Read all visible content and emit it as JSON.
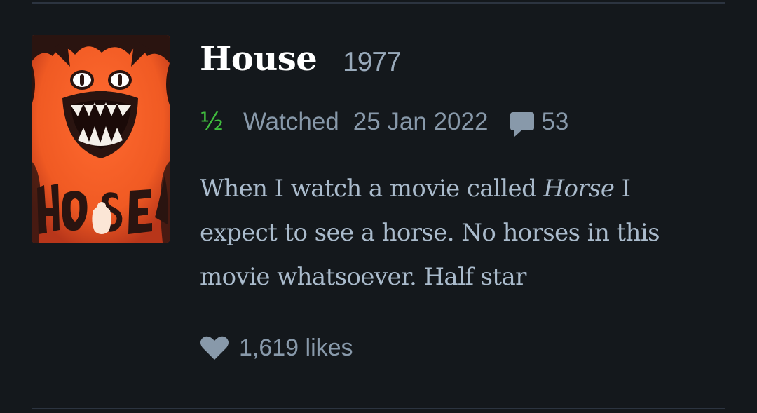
{
  "film": {
    "title": "House",
    "year": "1977",
    "poster_lettering": "HOUSE"
  },
  "entry": {
    "rating_text": "½",
    "watched_label": "Watched",
    "watched_date": "25 Jan 2022",
    "comments_icon": "speech-bubble-icon",
    "comments_count": "53"
  },
  "review": {
    "part1": "When I watch a movie called ",
    "emphasis": "Horse",
    "part2": " I expect to see a horse. No horses in this movie whatsoever. Half star"
  },
  "likes": {
    "icon": "heart-icon",
    "text": "1,619 likes"
  },
  "colors": {
    "background": "#14181c",
    "rating_green": "#40bc3e",
    "meta_gray": "#8899aa",
    "review_text": "#aabbcc",
    "title_white": "#ffffff",
    "poster_orange": "#f05a23"
  }
}
